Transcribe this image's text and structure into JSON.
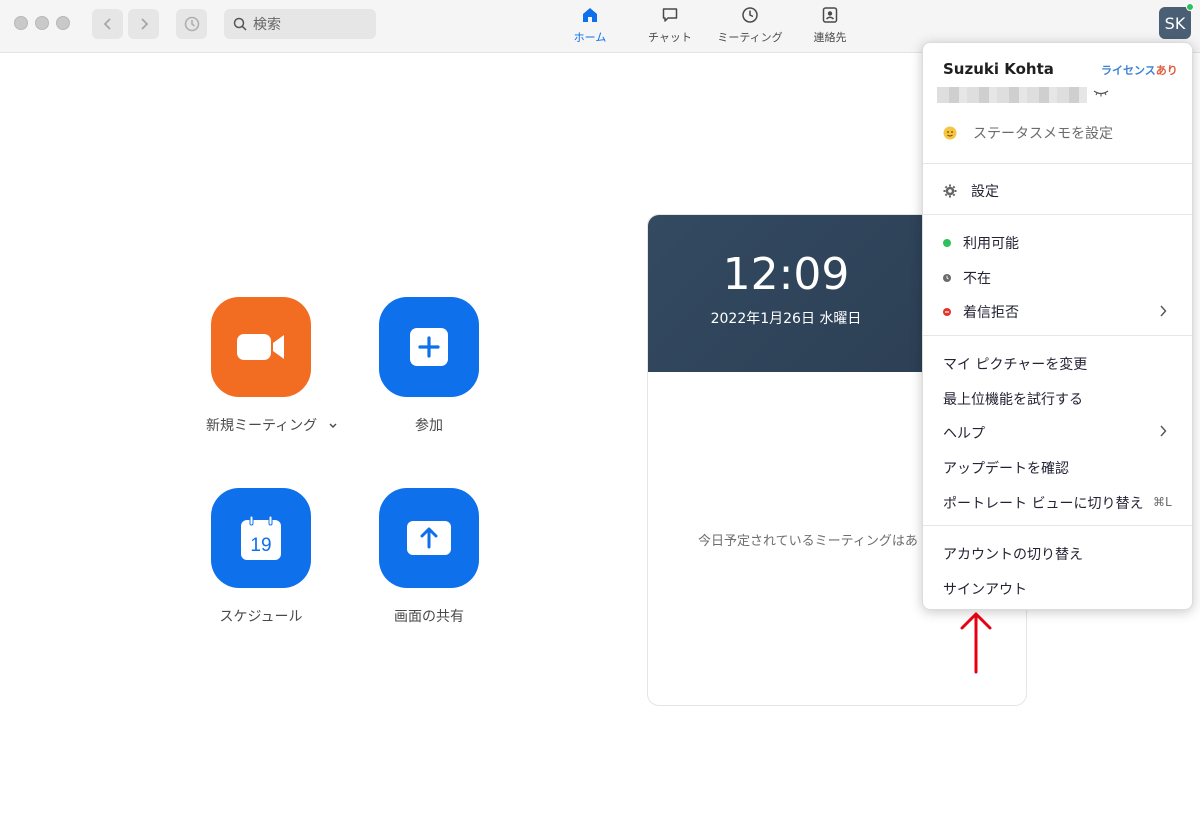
{
  "toolbar": {
    "search_placeholder": "検索"
  },
  "tabs": [
    {
      "label": "ホーム",
      "icon": "home-icon",
      "active": true
    },
    {
      "label": "チャット",
      "icon": "chat-icon",
      "active": false
    },
    {
      "label": "ミーティング",
      "icon": "clock-icon",
      "active": false
    },
    {
      "label": "連絡先",
      "icon": "contacts-icon",
      "active": false
    }
  ],
  "account": {
    "initials": "SK",
    "presence_color": "#2ec15b"
  },
  "home_actions": [
    {
      "label": "新規ミーティング",
      "icon": "video-camera-icon",
      "color": "#f26d21"
    },
    {
      "label": "参加",
      "icon": "plus-icon",
      "color": "#0e71eb"
    },
    {
      "label": "スケジュール",
      "icon": "calendar-icon",
      "calendar_day": "19",
      "color": "#0e71eb"
    },
    {
      "label": "画面の共有",
      "icon": "share-screen-icon",
      "color": "#0e71eb"
    }
  ],
  "calendar_card": {
    "time": "12:09",
    "date": "2022年1月26日 水曜日",
    "empty_message": "今日予定されているミーティングはあ"
  },
  "menu": {
    "user_name": "Suzuki Kohta",
    "license_part1": "ライセンス",
    "license_part2": "あり",
    "status_memo": "ステータスメモを設定",
    "settings": "設定",
    "available": "利用可能",
    "away": "不在",
    "do_not_disturb": "着信拒否",
    "change_picture": "マイ ピクチャーを変更",
    "try_top_features": "最上位機能を試行する",
    "help": "ヘルプ",
    "check_updates": "アップデートを確認",
    "portrait_view": "ポートレート ビューに切り替え",
    "portrait_shortcut": "⌘L",
    "switch_account": "アカウントの切り替え",
    "sign_out": "サインアウト",
    "colors": {
      "available": "#2ec15b",
      "away": "#6b6b6b",
      "dnd": "#e5352b"
    }
  },
  "annotation": {
    "arrow_color": "#e50012"
  }
}
